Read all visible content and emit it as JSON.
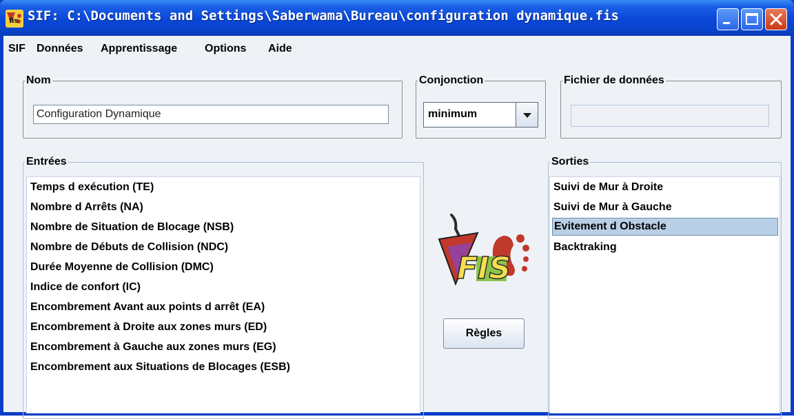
{
  "window": {
    "title": "SIF: C:\\Documents and Settings\\Saberwama\\Bureau\\configuration dynamique.fis"
  },
  "menu": [
    {
      "label": "SIF"
    },
    {
      "label": "Données"
    },
    {
      "label": "Apprentissage"
    },
    {
      "label": "Options"
    },
    {
      "label": "Aide"
    }
  ],
  "nom": {
    "title": "Nom",
    "value": "Configuration Dynamique"
  },
  "conjonction": {
    "title": "Conjonction",
    "selected": "minimum"
  },
  "fichier": {
    "title": "Fichier de données",
    "value": ""
  },
  "entrees": {
    "title": "Entrées",
    "items": [
      "Temps d exécution (TE)",
      "Nombre d Arrêts (NA)",
      "Nombre de Situation de Blocage (NSB)",
      "Nombre de Débuts de Collision (NDC)",
      "Durée Moyenne de Collision (DMC)",
      "Indice de confort (IC)",
      "Encombrement Avant aux points d arrêt  (EA)",
      "Encombrement à Droite aux zones murs (ED)",
      "Encombrement à Gauche aux zones murs (EG)",
      "Encombrement aux Situations de Blocages (ESB)"
    ]
  },
  "sorties": {
    "title": "Sorties",
    "items": [
      "Suivi de Mur à Droite",
      "Suivi de Mur à Gauche",
      "Evitement d Obstacle",
      "Backtraking"
    ],
    "selected_index": 2
  },
  "regles_button": "Règles",
  "logo_text": "FIS",
  "icons": {
    "app": "fis-app-icon",
    "minimize": "minimize-icon",
    "maximize": "maximize-icon",
    "close": "close-icon",
    "dropdown": "chevron-down-icon",
    "logo": "fis-logo"
  },
  "colors": {
    "titlebar": "#0a47d8",
    "client_bg": "#eef2f7",
    "selection": "#b8cfe5",
    "close_button": "#c83b18"
  }
}
